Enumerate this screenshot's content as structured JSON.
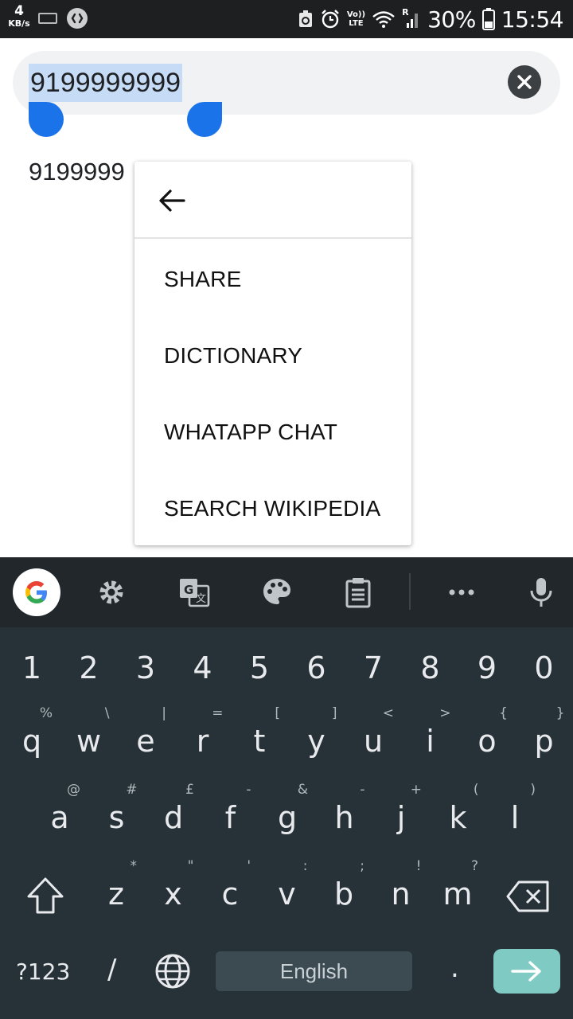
{
  "status_bar": {
    "net_speed_value": "4",
    "net_speed_unit": "KB/s",
    "volte_top": "Vo))",
    "volte_bottom": "LTE",
    "roaming": "R",
    "battery": "30%",
    "time": "15:54"
  },
  "search": {
    "query": "9199999999",
    "clear_icon": "close-icon"
  },
  "result": {
    "text": "9199999"
  },
  "context_menu": {
    "back_icon": "arrow-left-icon",
    "items": [
      "SHARE",
      "DICTIONARY",
      "WHATAPP CHAT",
      "SEARCH WIKIPEDIA"
    ]
  },
  "keyboard": {
    "toolbar_icons": [
      "google-g-icon",
      "gear-icon",
      "translate-icon",
      "palette-icon",
      "clipboard-icon",
      "more-dots-icon",
      "microphone-icon"
    ],
    "number_row": [
      "1",
      "2",
      "3",
      "4",
      "5",
      "6",
      "7",
      "8",
      "9",
      "0"
    ],
    "row1": [
      {
        "key": "q",
        "hint": "%"
      },
      {
        "key": "w",
        "hint": "\\"
      },
      {
        "key": "e",
        "hint": "|"
      },
      {
        "key": "r",
        "hint": "="
      },
      {
        "key": "t",
        "hint": "["
      },
      {
        "key": "y",
        "hint": "]"
      },
      {
        "key": "u",
        "hint": "<"
      },
      {
        "key": "i",
        "hint": ">"
      },
      {
        "key": "o",
        "hint": "{"
      },
      {
        "key": "p",
        "hint": "}"
      }
    ],
    "row2": [
      {
        "key": "a",
        "hint": "@"
      },
      {
        "key": "s",
        "hint": "#"
      },
      {
        "key": "d",
        "hint": "£"
      },
      {
        "key": "f",
        "hint": "-"
      },
      {
        "key": "g",
        "hint": "&"
      },
      {
        "key": "h",
        "hint": "-"
      },
      {
        "key": "j",
        "hint": "+"
      },
      {
        "key": "k",
        "hint": "("
      },
      {
        "key": "l",
        "hint": ")"
      }
    ],
    "row3": [
      {
        "key": "z",
        "hint": "*"
      },
      {
        "key": "x",
        "hint": "\""
      },
      {
        "key": "c",
        "hint": "'"
      },
      {
        "key": "v",
        "hint": ":"
      },
      {
        "key": "b",
        "hint": ";"
      },
      {
        "key": "n",
        "hint": "!"
      },
      {
        "key": "m",
        "hint": "?"
      }
    ],
    "symbols_label": "?123",
    "slash_label": "/",
    "space_label": "English",
    "period_label": ".",
    "accent_color": "#1a73e8",
    "enter_color": "#7fcbc4"
  }
}
